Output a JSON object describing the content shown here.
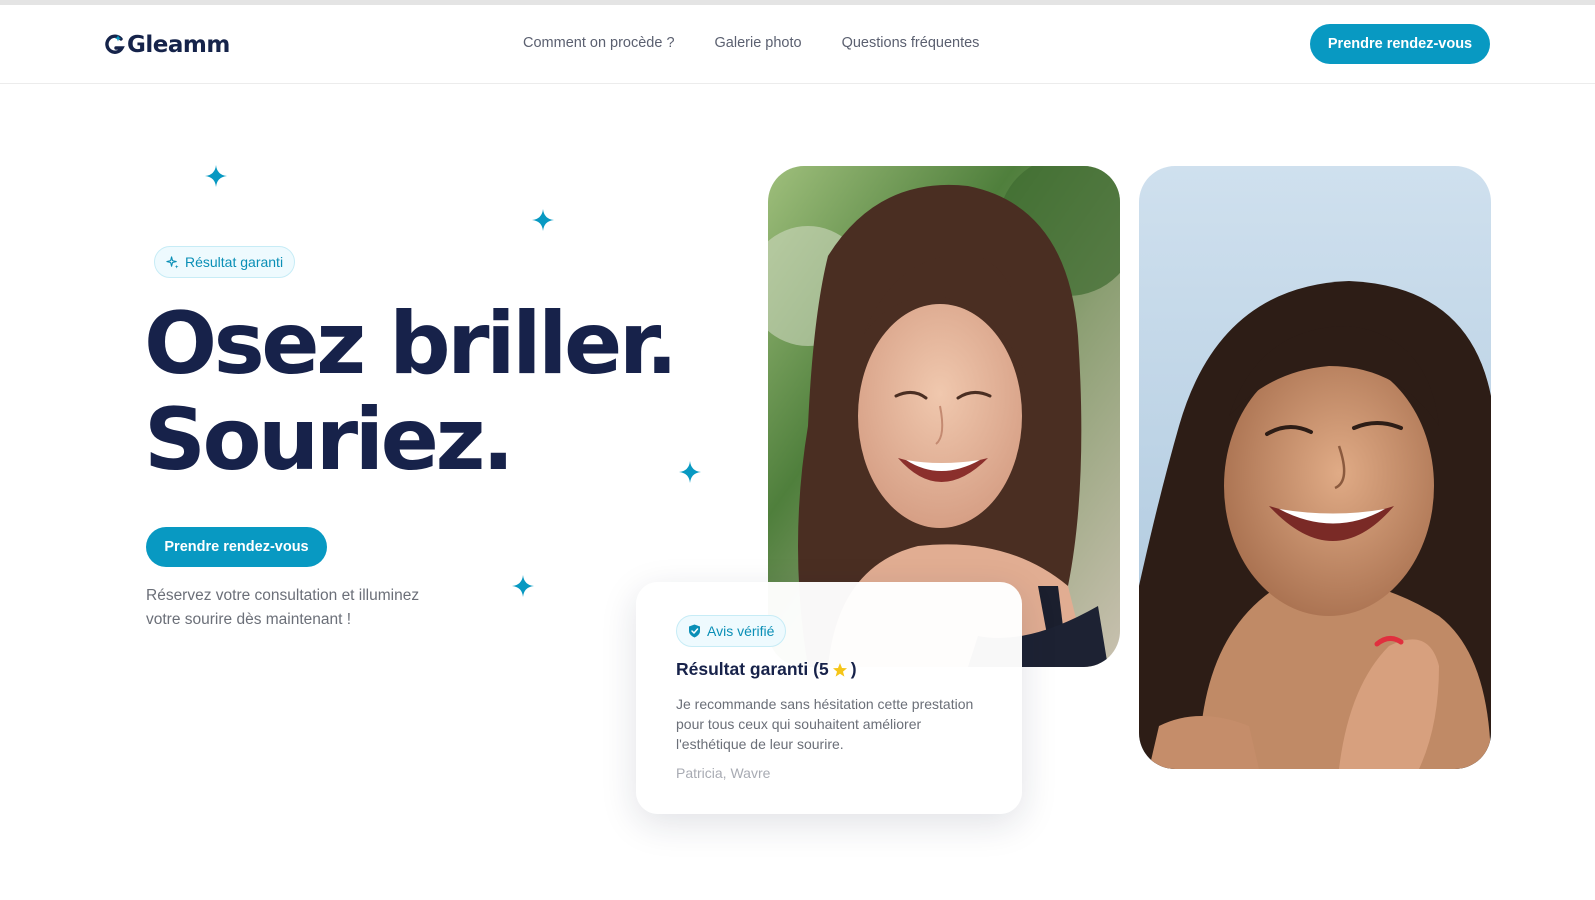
{
  "brand": {
    "name": "Gleamm",
    "accent_color": "#0899c2",
    "heading_color": "#17224a"
  },
  "nav": {
    "items": [
      {
        "label": "Comment on procède ?"
      },
      {
        "label": "Galerie photo"
      },
      {
        "label": "Questions fréquentes"
      }
    ],
    "cta_label": "Prendre rendez-vous"
  },
  "hero": {
    "badge_icon": "sparkles-icon",
    "badge_label": "Résultat garanti",
    "title_line1": "Osez briller.",
    "title_line2": "Souriez.",
    "cta_label": "Prendre rendez-vous",
    "subtitle": "Réservez votre consultation et illuminez votre sourire dès maintenant !"
  },
  "review": {
    "badge_icon": "shield-check-icon",
    "badge_label": "Avis vérifié",
    "title_prefix": "Résultat garanti (5",
    "title_suffix": ")",
    "rating": 5,
    "star_icon": "star-icon",
    "body": "Je recommande sans hésitation cette prestation pour tous ceux qui souhaitent améliorer l'esthétique de leur sourire.",
    "author": "Patricia, Wavre"
  }
}
